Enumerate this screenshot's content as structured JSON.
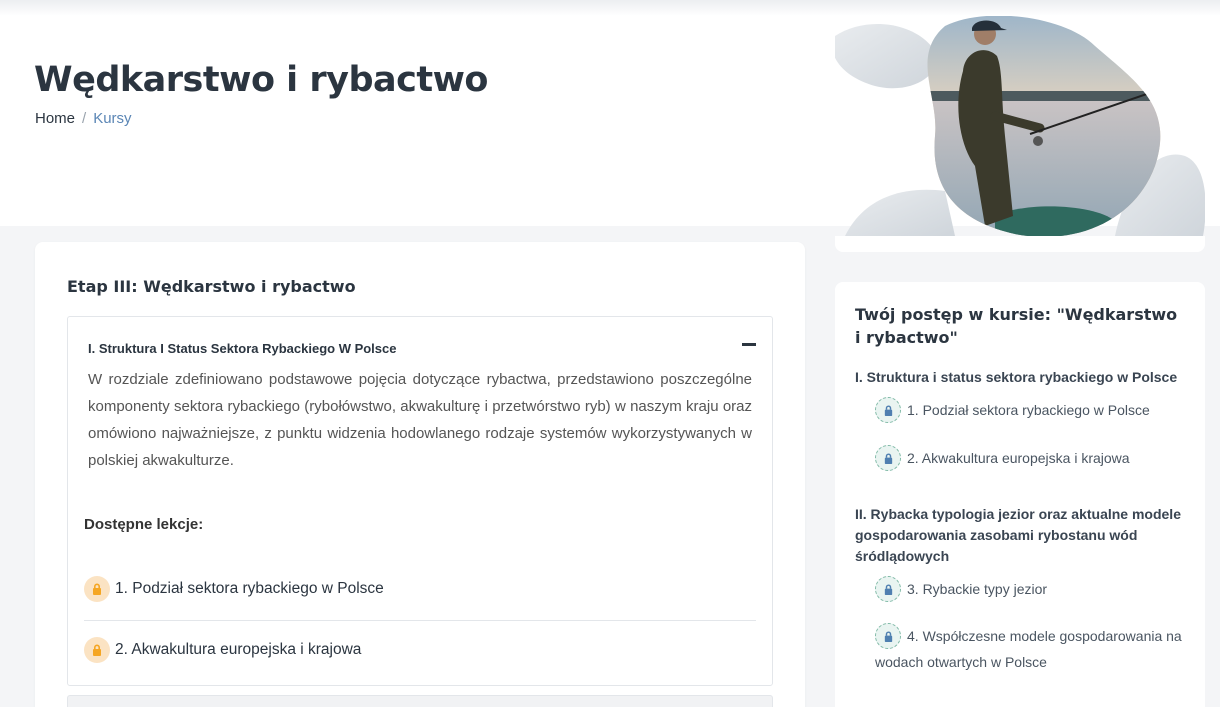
{
  "header": {
    "title": "Wędkarstwo i rybactwo",
    "breadcrumb": {
      "home": "Home",
      "separator": "/",
      "current": "Kursy"
    }
  },
  "main": {
    "stage_title": "Etap III: Wędkarstwo i rybactwo",
    "chapter": {
      "title": "I. Struktura I Status Sektora Rybackiego W Polsce",
      "expanded": true,
      "description": "W rozdziale zdefiniowano podstawowe pojęcia dotyczące rybactwa, przedstawiono poszczególne komponenty sektora rybackiego (rybołówstwo, akwakulturę i przetwórstwo ryb) w naszym kraju oraz omówiono najważniejsze, z punktu widzenia hodowlanego rodzaje systemów wykorzystywanych w polskiej akwakulturze.",
      "lessons_heading": "Dostępne lekcje:",
      "lessons": [
        {
          "label": "1. Podział sektora rybackiego w Polsce",
          "icon": "lock-icon"
        },
        {
          "label": "2. Akwakultura europejska i krajowa",
          "icon": "lock-icon"
        }
      ]
    }
  },
  "sidebar": {
    "progress_prefix": "Twój postęp w kursie: ",
    "progress_course": "\"Wędkarstwo i rybactwo\"",
    "sections": [
      {
        "title": "I. Struktura i status sektora rybackiego w Polsce",
        "lessons": [
          "1. Podział sektora rybackiego w Polsce",
          "2. Akwakultura europejska i krajowa"
        ]
      },
      {
        "title": "II. Rybacka typologia jezior oraz aktualne modele gospodarowania zasobami rybostanu wód śródlądowych",
        "lessons": [
          "3. Rybackie typy jezior",
          "4. Współczesne modele gospodarowania na wodach otwartych w Polsce"
        ]
      }
    ]
  },
  "colors": {
    "title": "#2b3540",
    "breadcrumb_active": "#5b86b5",
    "lock_orange": "#f5a623",
    "lock_blue": "#4f7fb0"
  }
}
